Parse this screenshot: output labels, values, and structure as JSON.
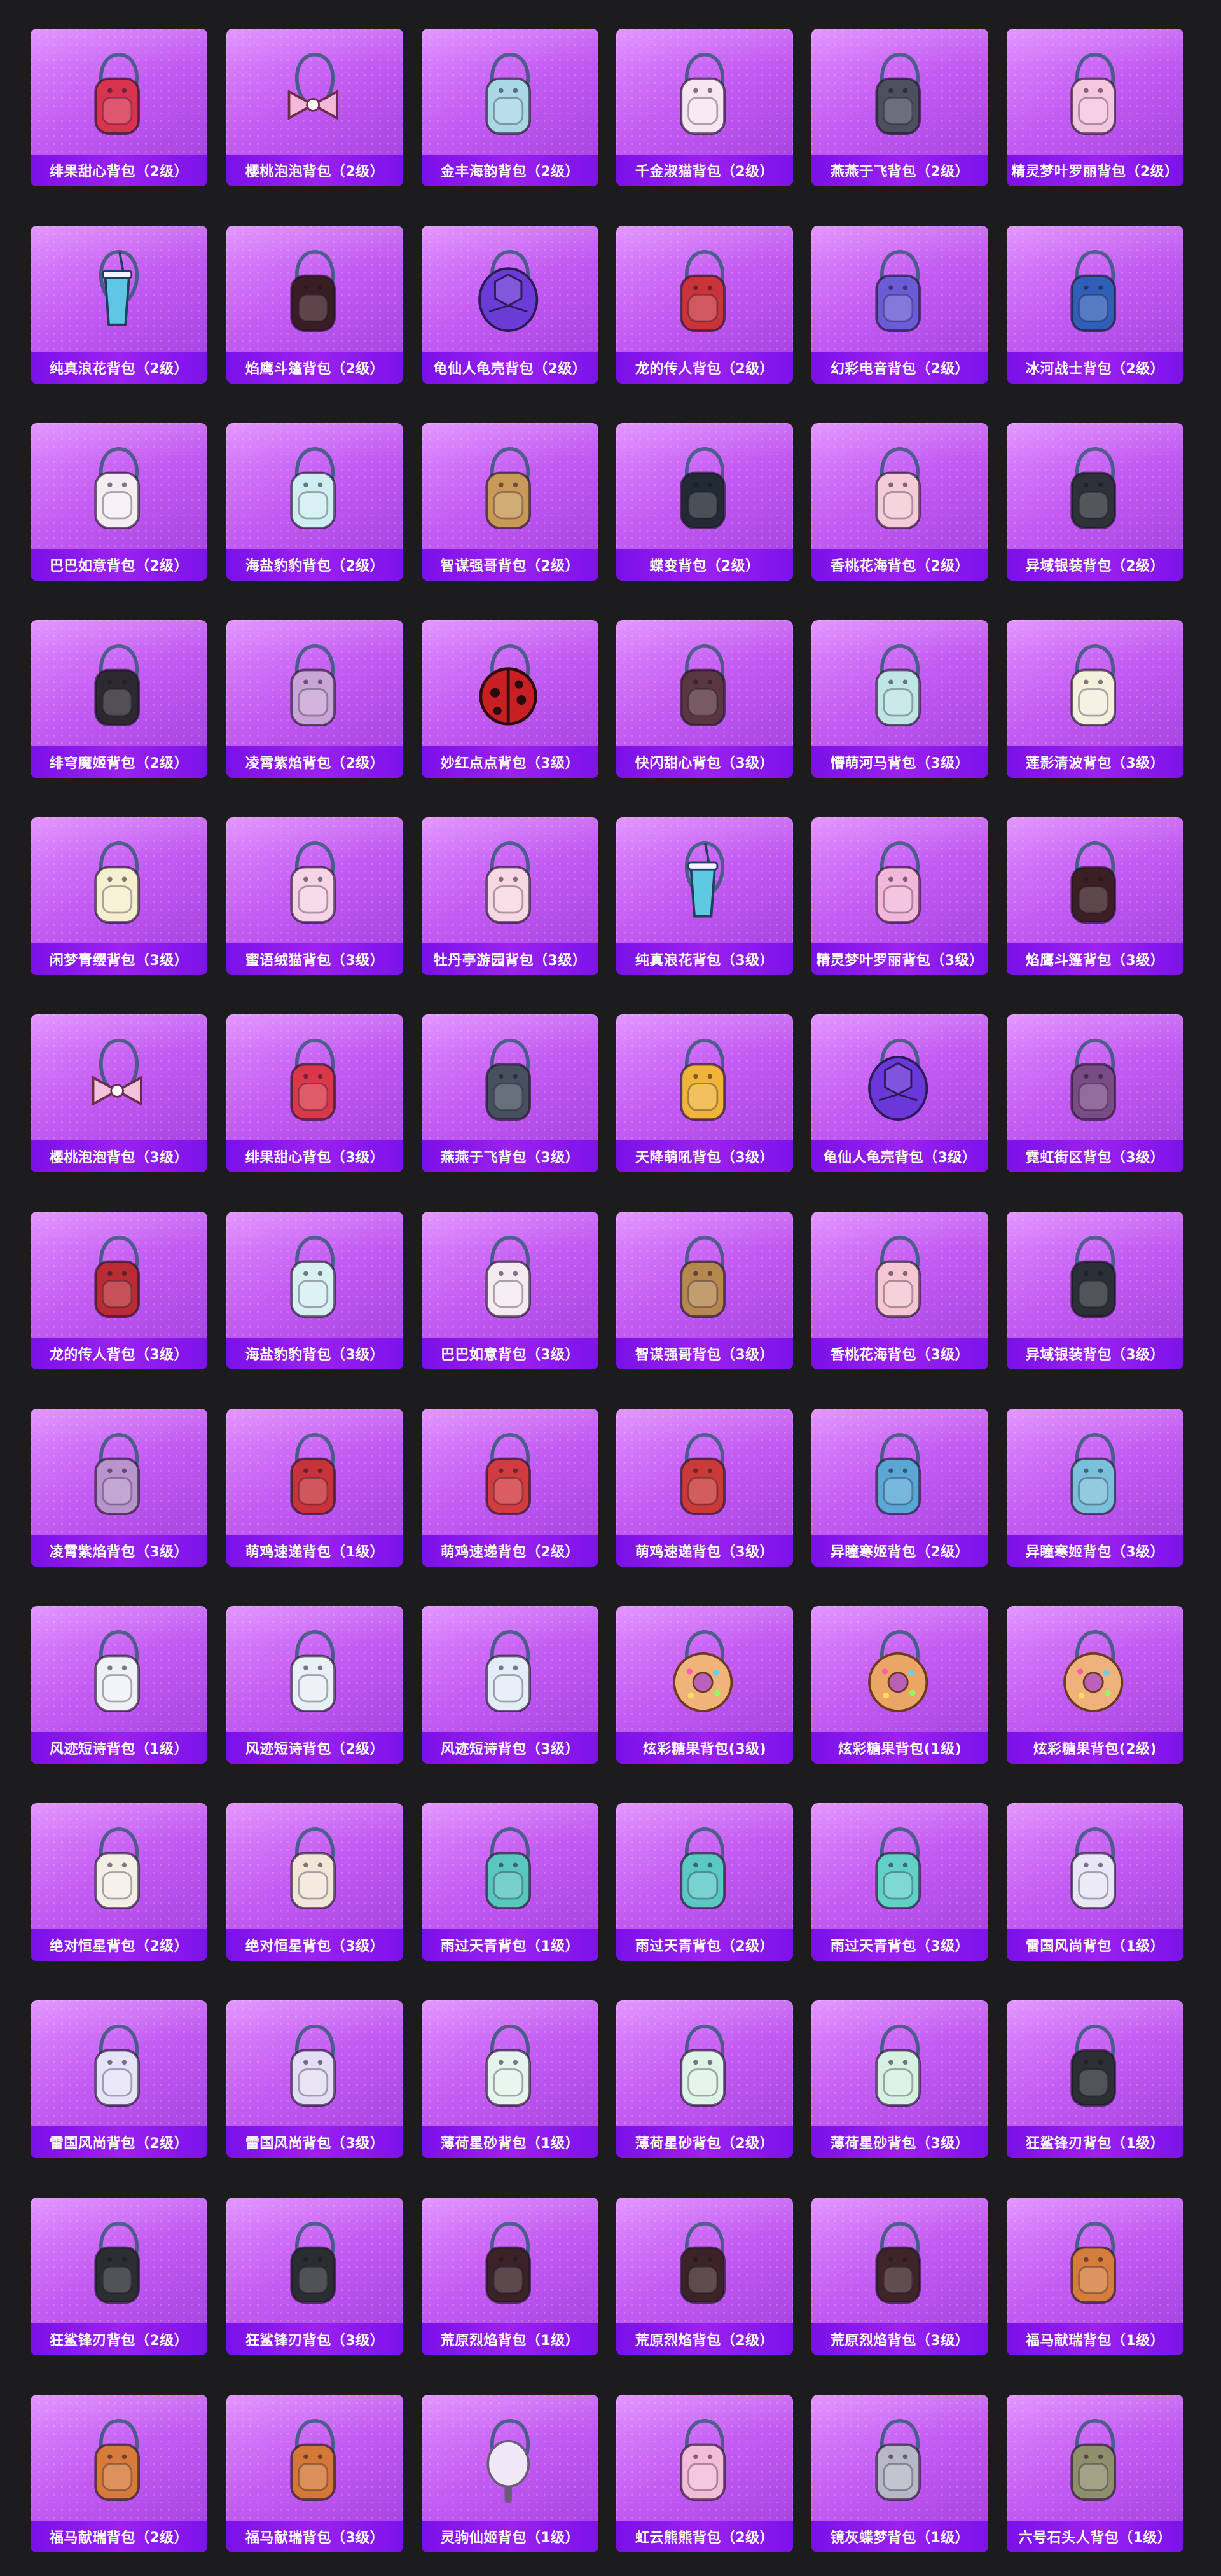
{
  "items": [
    {
      "name": "绯果甜心背包（2级）",
      "icon": "backpack-icon",
      "color": "#d8334f"
    },
    {
      "name": "樱桃泡泡背包（2级）",
      "icon": "bow-backpack-icon",
      "color": "#f3b9d6"
    },
    {
      "name": "金丰海韵背包（2级）",
      "icon": "backpack-icon",
      "color": "#a9d7e4"
    },
    {
      "name": "千金淑猫背包（2级）",
      "icon": "backpack-icon",
      "color": "#f7e6ef"
    },
    {
      "name": "燕燕于飞背包（2级）",
      "icon": "backpack-icon",
      "color": "#4b4f5e"
    },
    {
      "name": "精灵梦叶罗丽背包（2级）",
      "icon": "backpack-icon",
      "color": "#f5c6e0"
    },
    {
      "name": "纯真浪花背包（2级）",
      "icon": "drink-backpack-icon",
      "color": "#5fc6e6"
    },
    {
      "name": "焰鹰斗篷背包（2级）",
      "icon": "backpack-icon",
      "color": "#3a1d24"
    },
    {
      "name": "龟仙人龟壳背包（2级）",
      "icon": "turtle-shell-backpack-icon",
      "color": "#6b3bd6"
    },
    {
      "name": "龙的传人背包（2级）",
      "icon": "backpack-icon",
      "color": "#c8343a"
    },
    {
      "name": "幻彩电音背包（2级）",
      "icon": "backpack-icon",
      "color": "#6a5bd6"
    },
    {
      "name": "冰河战士背包（2级）",
      "icon": "backpack-icon",
      "color": "#2f5fb7"
    },
    {
      "name": "巴巴如意背包（2级）",
      "icon": "backpack-icon",
      "color": "#f4eef2"
    },
    {
      "name": "海盐豹豹背包（2级）",
      "icon": "backpack-icon",
      "color": "#cfeef2"
    },
    {
      "name": "智谋强哥背包（2级）",
      "icon": "backpack-icon",
      "color": "#c99a57"
    },
    {
      "name": "蝶变背包（2级）",
      "icon": "backpack-icon",
      "color": "#222a33"
    },
    {
      "name": "香桃花海背包（2级）",
      "icon": "backpack-icon",
      "color": "#f4cbd6"
    },
    {
      "name": "异域银装背包（2级）",
      "icon": "backpack-icon",
      "color": "#2c3237"
    },
    {
      "name": "绯穹魔姬背包（2级）",
      "icon": "backpack-icon",
      "color": "#2d2930"
    },
    {
      "name": "凌霄紫焰背包（2级）",
      "icon": "backpack-icon",
      "color": "#c9a4d6"
    },
    {
      "name": "妙红点点背包（3级）",
      "icon": "ladybug-backpack-icon",
      "color": "#c81e24"
    },
    {
      "name": "快闪甜心背包（3级）",
      "icon": "backpack-icon",
      "color": "#5a3640"
    },
    {
      "name": "懵萌河马背包（3级）",
      "icon": "backpack-icon",
      "color": "#bfe5e5"
    },
    {
      "name": "莲影清波背包（3级）",
      "icon": "backpack-icon",
      "color": "#f5f0dd"
    },
    {
      "name": "闲梦青缨背包（3级）",
      "icon": "backpack-icon",
      "color": "#f6efcf"
    },
    {
      "name": "蜜语绒猫背包（3级）",
      "icon": "backpack-icon",
      "color": "#f6d4e6"
    },
    {
      "name": "牡丹亭游园背包（3级）",
      "icon": "backpack-icon",
      "color": "#f7d7e2"
    },
    {
      "name": "纯真浪花背包（3级）",
      "icon": "drink-backpack-icon",
      "color": "#5ec9e2"
    },
    {
      "name": "精灵梦叶罗丽背包（3级）",
      "icon": "backpack-icon",
      "color": "#f2b7d9"
    },
    {
      "name": "焰鹰斗篷背包（3级）",
      "icon": "backpack-icon",
      "color": "#3b1f25"
    },
    {
      "name": "樱桃泡泡背包（3级）",
      "icon": "bow-backpack-icon",
      "color": "#f4c2dd"
    },
    {
      "name": "绯果甜心背包（3级）",
      "icon": "backpack-icon",
      "color": "#d9374a"
    },
    {
      "name": "燕燕于飞背包（3级）",
      "icon": "backpack-icon",
      "color": "#46505e"
    },
    {
      "name": "天降萌吼背包（3级）",
      "icon": "backpack-icon",
      "color": "#f0b43b"
    },
    {
      "name": "龟仙人龟壳背包（3级）",
      "icon": "turtle-shell-backpack-icon",
      "color": "#6a37d8"
    },
    {
      "name": "霓虹街区背包（3级）",
      "icon": "backpack-icon",
      "color": "#7a4c86"
    },
    {
      "name": "龙的传人背包（3级）",
      "icon": "backpack-icon",
      "color": "#b92c34"
    },
    {
      "name": "海盐豹豹背包（3级）",
      "icon": "backpack-icon",
      "color": "#d7f0f1"
    },
    {
      "name": "巴巴如意背包（3级）",
      "icon": "backpack-icon",
      "color": "#f5eaf0"
    },
    {
      "name": "智谋强哥背包（3级）",
      "icon": "backpack-icon",
      "color": "#b58850"
    },
    {
      "name": "香桃花海背包（3级）",
      "icon": "backpack-icon",
      "color": "#f4c7d3"
    },
    {
      "name": "异域银装背包（3级）",
      "icon": "backpack-icon",
      "color": "#2a3035"
    },
    {
      "name": "凌霄紫焰背包（3级）",
      "icon": "backpack-icon",
      "color": "#b893cc"
    },
    {
      "name": "萌鸡速递背包（1级）",
      "icon": "backpack-icon",
      "color": "#c8323a"
    },
    {
      "name": "萌鸡速递背包（2级）",
      "icon": "backpack-icon",
      "color": "#d23b3f"
    },
    {
      "name": "萌鸡速递背包（3级）",
      "icon": "backpack-icon",
      "color": "#c93a38"
    },
    {
      "name": "异瞳寒姬背包（2级）",
      "icon": "backpack-icon",
      "color": "#5aa7d6"
    },
    {
      "name": "异瞳寒姬背包（3级）",
      "icon": "backpack-icon",
      "color": "#7ac0da"
    },
    {
      "name": "风迹短诗背包（1级）",
      "icon": "backpack-icon",
      "color": "#eef2f7"
    },
    {
      "name": "风迹短诗背包（2级）",
      "icon": "backpack-icon",
      "color": "#e9f0f7"
    },
    {
      "name": "风迹短诗背包（3级）",
      "icon": "backpack-icon",
      "color": "#e3ecf7"
    },
    {
      "name": "炫彩糖果背包(3级)",
      "icon": "donut-backpack-icon",
      "color": "#f0b37a"
    },
    {
      "name": "炫彩糖果背包(1级)",
      "icon": "donut-backpack-icon",
      "color": "#e9a664"
    },
    {
      "name": "炫彩糖果背包(2级)",
      "icon": "donut-backpack-icon",
      "color": "#efb27d"
    },
    {
      "name": "绝对恒星背包（2级）",
      "icon": "backpack-icon",
      "color": "#f2efe6"
    },
    {
      "name": "绝对恒星背包（3级）",
      "icon": "backpack-icon",
      "color": "#f2e6d9"
    },
    {
      "name": "雨过天青背包（1级）",
      "icon": "backpack-icon",
      "color": "#59c6c0"
    },
    {
      "name": "雨过天青背包（2级）",
      "icon": "backpack-icon",
      "color": "#5bc8c6"
    },
    {
      "name": "雨过天青背包（3级）",
      "icon": "backpack-icon",
      "color": "#63d0c8"
    },
    {
      "name": "雷国风尚背包（1级）",
      "icon": "backpack-icon",
      "color": "#e9e6f6"
    },
    {
      "name": "雷国风尚背包（2级）",
      "icon": "backpack-icon",
      "color": "#e6e2f8"
    },
    {
      "name": "雷国风尚背包（3级）",
      "icon": "backpack-icon",
      "color": "#e3def5"
    },
    {
      "name": "薄荷星砂背包（1级）",
      "icon": "backpack-icon",
      "color": "#e5f4ec"
    },
    {
      "name": "薄荷星砂背包（2级）",
      "icon": "backpack-icon",
      "color": "#dff3e8"
    },
    {
      "name": "薄荷星砂背包（3级）",
      "icon": "backpack-icon",
      "color": "#d6f0e2"
    },
    {
      "name": "狂鲨锋刃背包（1级）",
      "icon": "backpack-icon",
      "color": "#2c2f33"
    },
    {
      "name": "狂鲨锋刃背包（2级）",
      "icon": "backpack-icon",
      "color": "#2b2f32"
    },
    {
      "name": "狂鲨锋刃背包（3级）",
      "icon": "backpack-icon",
      "color": "#2a2e31"
    },
    {
      "name": "荒原烈焰背包（1级）",
      "icon": "backpack-icon",
      "color": "#3a2227"
    },
    {
      "name": "荒原烈焰背包（2级）",
      "icon": "backpack-icon",
      "color": "#3c2328"
    },
    {
      "name": "荒原烈焰背包（3级）",
      "icon": "backpack-icon",
      "color": "#3f2529"
    },
    {
      "name": "福马献瑞背包（1级）",
      "icon": "backpack-icon",
      "color": "#d57d3d"
    },
    {
      "name": "福马献瑞背包（2级）",
      "icon": "backpack-icon",
      "color": "#d67b3b"
    },
    {
      "name": "福马献瑞背包（3级）",
      "icon": "backpack-icon",
      "color": "#d47838"
    },
    {
      "name": "灵驹仙姬背包（1级）",
      "icon": "mirror-backpack-icon",
      "color": "#efe8f6"
    },
    {
      "name": "虹云熊熊背包（2级）",
      "icon": "backpack-icon",
      "color": "#f3bcd8"
    },
    {
      "name": "镜灰蝶梦背包（1级）",
      "icon": "backpack-icon",
      "color": "#b7b7c7"
    },
    {
      "name": "六号石头人背包（1级）",
      "icon": "backpack-icon",
      "color": "#8e8f6c"
    }
  ]
}
